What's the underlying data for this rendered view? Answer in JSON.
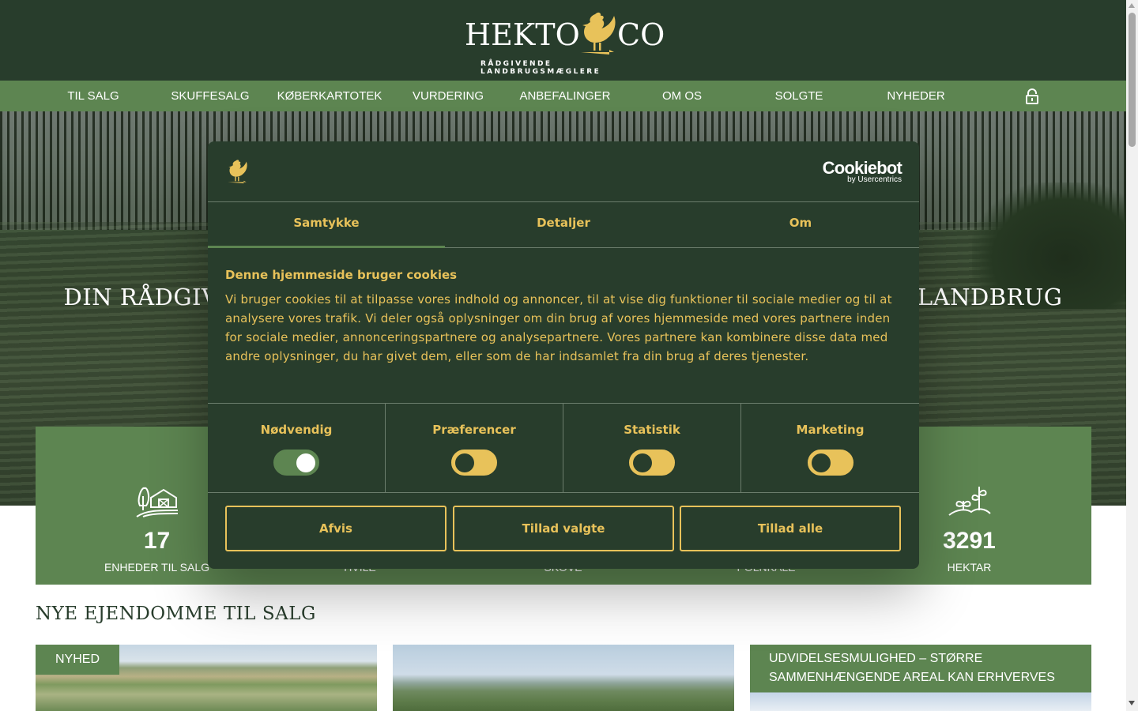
{
  "brand": {
    "name_left": "HEKTO",
    "name_right": "CO",
    "tagline": "RÅDGIVENDE LANDBRUGSMÆGLERE",
    "primary_dark": "#283d2c",
    "primary_green": "#5d8551",
    "accent_gold": "#e8c25a"
  },
  "nav": {
    "items": [
      {
        "label": "TIL SALG"
      },
      {
        "label": "SKUFFESALG"
      },
      {
        "label": "KØBERKARTOTEK"
      },
      {
        "label": "VURDERING"
      },
      {
        "label": "ANBEFALINGER"
      },
      {
        "label": "OM OS"
      },
      {
        "label": "SOLGTE"
      },
      {
        "label": "NYHEDER"
      }
    ],
    "lock_icon": "lock-icon"
  },
  "hero": {
    "title_left": "DIN RÅDGIV",
    "title_right": "L LANDBRUG"
  },
  "stats": [
    {
      "icon": "farm-icon",
      "value": "17",
      "label": "ENHEDER TIL SALG"
    },
    {
      "icon": "hidden",
      "value": "",
      "label": "HVILE"
    },
    {
      "icon": "hidden",
      "value": "",
      "label": "SKOVE"
    },
    {
      "icon": "hidden",
      "value": "",
      "label": "POLNKALE"
    },
    {
      "icon": "plant-icon",
      "value": "3291",
      "label": "HEKTAR"
    }
  ],
  "section": {
    "title": "NYE EJENDOMME TIL SALG"
  },
  "cards": [
    {
      "badge": "NYHED"
    },
    {
      "badge": ""
    },
    {
      "badge": "UDVIDELSESMULIGHED – STØRRE SAMMENHÆNGENDE AREAL KAN ERHVERVES"
    }
  ],
  "cookie": {
    "provider_main": "Cookiebot",
    "provider_sub": "by Usercentrics",
    "tabs": [
      {
        "label": "Samtykke",
        "active": true
      },
      {
        "label": "Detaljer",
        "active": false
      },
      {
        "label": "Om",
        "active": false
      }
    ],
    "title": "Denne hjemmeside bruger cookies",
    "text": "Vi bruger cookies til at tilpasse vores indhold og annoncer, til at vise dig funktioner til sociale medier og til at analysere vores trafik. Vi deler også oplysninger om din brug af vores hjemmeside med vores partnere inden for sociale medier, annonceringspartnere og analysepartnere. Vores partnere kan kombinere disse data med andre oplysninger, du har givet dem, eller som de har indsamlet fra din brug af deres tjenester.",
    "toggles": [
      {
        "label": "Nødvendig",
        "on": true
      },
      {
        "label": "Præferencer",
        "on": false
      },
      {
        "label": "Statistik",
        "on": false
      },
      {
        "label": "Marketing",
        "on": false
      }
    ],
    "buttons": {
      "deny": "Afvis",
      "allow_selected": "Tillad valgte",
      "allow_all": "Tillad alle"
    }
  }
}
